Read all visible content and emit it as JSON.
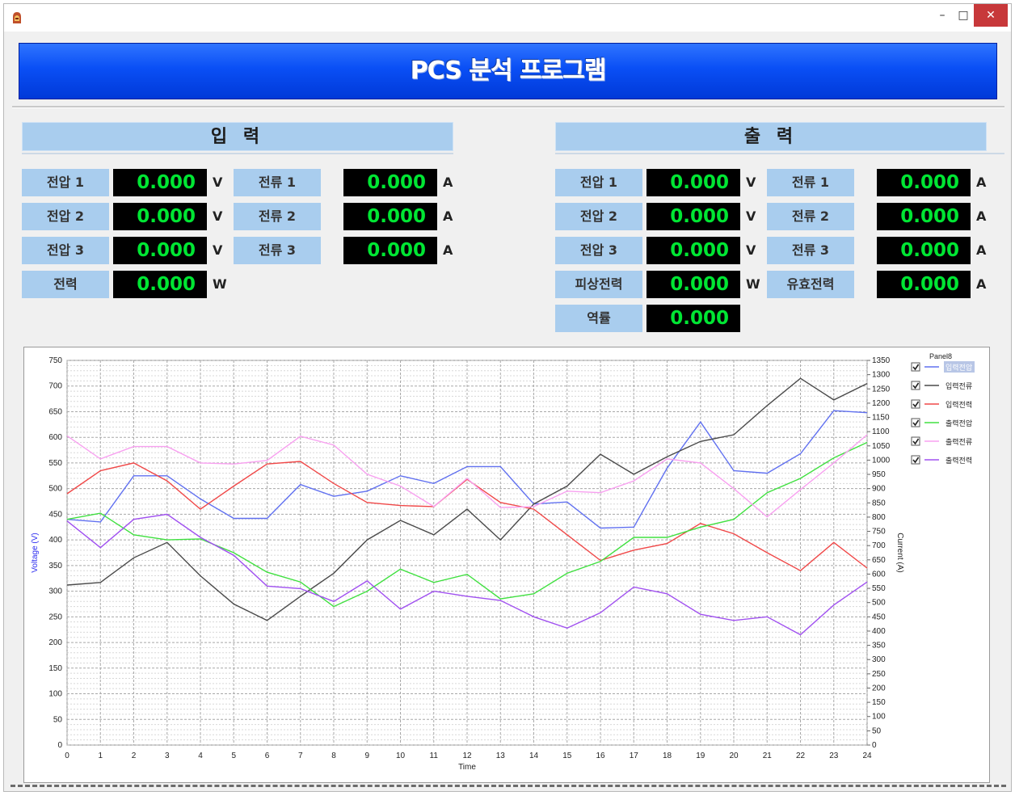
{
  "window": {
    "minimize": "–",
    "maximize": "□",
    "close": "✕"
  },
  "header": {
    "title": "PCS 분석 프로그램"
  },
  "input": {
    "title": "입  력",
    "voltage": [
      {
        "label": "전압 1",
        "value": "0.000",
        "unit": "V"
      },
      {
        "label": "전압 2",
        "value": "0.000",
        "unit": "V"
      },
      {
        "label": "전압 3",
        "value": "0.000",
        "unit": "V"
      }
    ],
    "current": [
      {
        "label": "전류 1",
        "value": "0.000",
        "unit": "A"
      },
      {
        "label": "전류 2",
        "value": "0.000",
        "unit": "A"
      },
      {
        "label": "전류 3",
        "value": "0.000",
        "unit": "A"
      }
    ],
    "power": {
      "label": "전력",
      "value": "0.000",
      "unit": "W"
    }
  },
  "output": {
    "title": "출  력",
    "voltage": [
      {
        "label": "전압 1",
        "value": "0.000",
        "unit": "V"
      },
      {
        "label": "전압 2",
        "value": "0.000",
        "unit": "V"
      },
      {
        "label": "전압 3",
        "value": "0.000",
        "unit": "V"
      }
    ],
    "current": [
      {
        "label": "전류 1",
        "value": "0.000",
        "unit": "A"
      },
      {
        "label": "전류 2",
        "value": "0.000",
        "unit": "A"
      },
      {
        "label": "전류 3",
        "value": "0.000",
        "unit": "A"
      }
    ],
    "apparent_power": {
      "label": "피상전력",
      "value": "0.000",
      "unit": "W"
    },
    "active_power": {
      "label": "유효전력",
      "value": "0.000",
      "unit": "A"
    },
    "power_factor": {
      "label": "역률",
      "value": "0.000"
    }
  },
  "chart_data": {
    "type": "line",
    "xlabel": "Time",
    "ylabel": "Voltage (V)",
    "y2label": "Current (A)",
    "legend_title": "Panel8",
    "legend_position": "right",
    "grid": true,
    "xlim": [
      0,
      24
    ],
    "ylim": [
      0,
      750
    ],
    "y2lim": [
      0,
      1350
    ],
    "x": [
      0,
      1,
      2,
      3,
      4,
      5,
      6,
      7,
      8,
      9,
      10,
      11,
      12,
      13,
      14,
      15,
      16,
      17,
      18,
      19,
      20,
      21,
      22,
      23,
      24
    ],
    "series": [
      {
        "name": "입력전압",
        "color": "#6070f0",
        "values": [
          440,
          435,
          525,
          525,
          480,
          442,
          442,
          508,
          485,
          495,
          525,
          510,
          543,
          543,
          470,
          474,
          423,
          425,
          540,
          630,
          535,
          530,
          568,
          652,
          648
        ]
      },
      {
        "name": "입력전류",
        "color": "#4a4a4a",
        "values": [
          312,
          317,
          365,
          395,
          330,
          275,
          243,
          290,
          335,
          400,
          438,
          410,
          460,
          400,
          470,
          505,
          567,
          528,
          562,
          592,
          605,
          662,
          715,
          673,
          705
        ]
      },
      {
        "name": "입력전력",
        "color": "#f04848",
        "values": [
          490,
          535,
          550,
          515,
          460,
          505,
          548,
          553,
          510,
          473,
          467,
          465,
          518,
          473,
          460,
          410,
          360,
          380,
          393,
          432,
          412,
          375,
          340,
          395,
          345
        ]
      },
      {
        "name": "출력전압",
        "color": "#40e040",
        "values": [
          440,
          452,
          410,
          400,
          402,
          375,
          337,
          318,
          270,
          300,
          343,
          317,
          333,
          285,
          295,
          335,
          358,
          405,
          405,
          425,
          440,
          492,
          520,
          560,
          590
        ]
      },
      {
        "name": "출력전류",
        "color": "#f8a0f0",
        "values": [
          603,
          558,
          582,
          582,
          550,
          548,
          555,
          602,
          585,
          528,
          505,
          465,
          520,
          463,
          465,
          495,
          492,
          515,
          558,
          550,
          500,
          445,
          498,
          550,
          605
        ]
      },
      {
        "name": "출력전력",
        "color": "#a050f0",
        "values": [
          437,
          385,
          440,
          450,
          405,
          370,
          310,
          305,
          280,
          320,
          265,
          300,
          290,
          282,
          250,
          228,
          258,
          308,
          295,
          255,
          243,
          250,
          215,
          273,
          318
        ]
      }
    ]
  }
}
